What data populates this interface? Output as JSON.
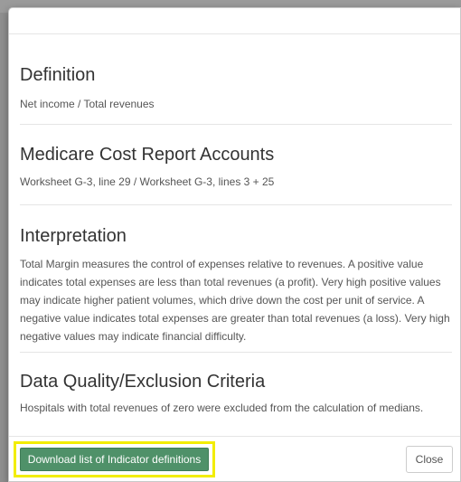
{
  "sections": [
    {
      "title": "Definition",
      "text": "Net income / Total revenues"
    },
    {
      "title": "Medicare Cost Report Accounts",
      "text": "Worksheet G-3, line 29 / Worksheet G-3, lines 3 + 25"
    },
    {
      "title": "Interpretation",
      "text": "Total Margin measures the control of expenses relative to revenues. A positive value indicates total expenses are less than total revenues (a profit). Very high positive values may indicate higher patient volumes, which drive down the cost per unit of service. A negative value indicates total expenses are greater than total revenues (a loss). Very high negative values may indicate financial difficulty."
    },
    {
      "title": "Data Quality/Exclusion Criteria",
      "text": "Hospitals with total revenues of zero were excluded from the calculation of medians."
    }
  ],
  "footer": {
    "download_label": "Download list of Indicator definitions",
    "close_label": "Close"
  },
  "colors": {
    "download_button": "#4f9169",
    "highlight": "#f2ed00"
  }
}
